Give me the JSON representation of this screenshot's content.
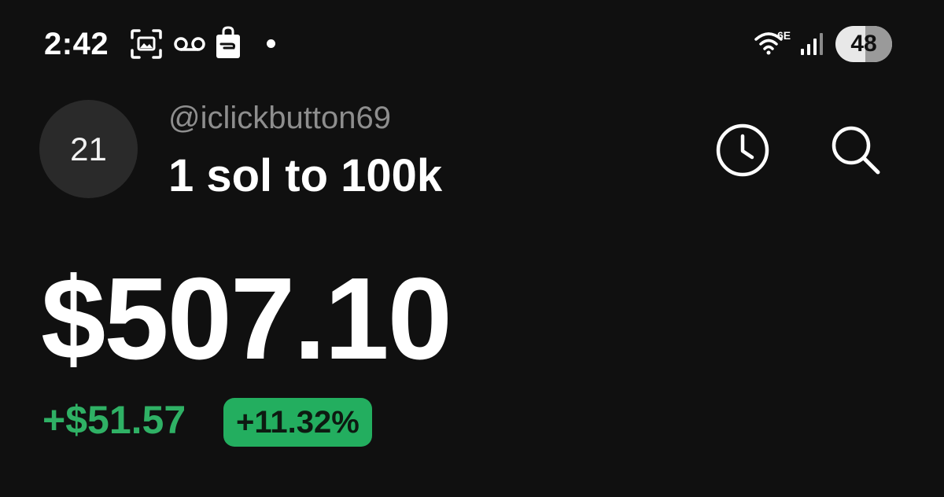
{
  "status_bar": {
    "time": "2:42",
    "network": "6E",
    "battery": "48",
    "icons": [
      "screenshot-icon",
      "voicemail-icon",
      "shopping-bag-icon",
      "notification-dot",
      "wifi-icon",
      "signal-icon",
      "battery-icon"
    ]
  },
  "header": {
    "avatar_text": "21",
    "username": "@iclickbutton69",
    "portfolio_name": "1 sol to 100k",
    "actions": [
      "history-icon",
      "search-icon"
    ]
  },
  "portfolio": {
    "balance": "$507.10",
    "change_amount": "+$51.57",
    "change_percent": "+11.32%"
  },
  "colors": {
    "background": "#101010",
    "positive": "#2fb165",
    "badge": "#23ae5f",
    "muted_text": "#8e8e8e"
  }
}
